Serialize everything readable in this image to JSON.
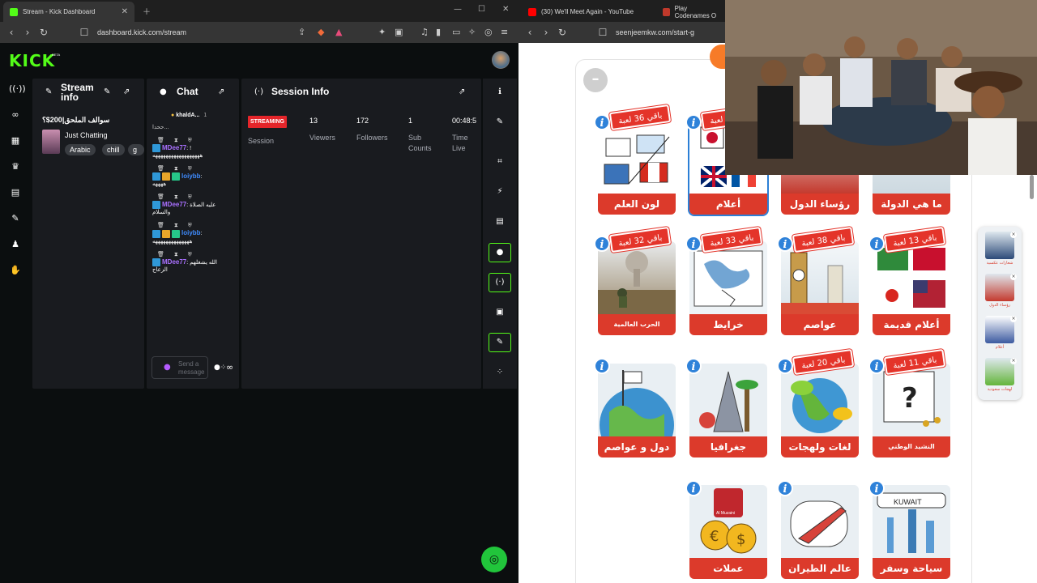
{
  "left_browser": {
    "tab_title": "Stream - Kick Dashboard",
    "url": "dashboard.kick.com/stream",
    "brand_color": "#53fc18"
  },
  "kick": {
    "logo": "KICK",
    "beta": "BETA",
    "rail_icons": [
      "broadcast-icon",
      "link-icon",
      "analytics-icon",
      "trophy-icon",
      "video-icon",
      "wrench-icon",
      "users-icon",
      "hand-icon"
    ]
  },
  "stream_info": {
    "title": "Stream info",
    "stream_title": "سوالف الملحق|200$؟",
    "category": "Just Chatting",
    "tags": [
      "Arabic",
      "chill",
      "g"
    ]
  },
  "chat": {
    "title": "Chat",
    "pinned_user": "khaldA...",
    "pinned_count": "1",
    "partial_top": "ححدا...",
    "messages": [
      {
        "user": "MDee77",
        "color": "#a970ff",
        "text": "!",
        "text2": "ههههههههههههههههههه"
      },
      {
        "user": "loiybb",
        "color": "#3f8cff",
        "text": "",
        "text2": "ههههه"
      },
      {
        "user": "MDee77",
        "color": "#a970ff",
        "text": "عليه الصلاة",
        "text2": "والسلام"
      },
      {
        "user": "loiybb",
        "color": "#3f8cff",
        "text": "",
        "text2": "ههههههههههههههه"
      },
      {
        "user": "MDee77",
        "color": "#a970ff",
        "text": "الله يشغلهم",
        "text2": "الزعاج"
      }
    ],
    "input_placeholder": "Send a message",
    "infinity": "∞"
  },
  "session": {
    "title": "Session Info",
    "status_badge": "STREAMING",
    "session_label": "Session",
    "stats": [
      {
        "value": "13",
        "label": "Viewers"
      },
      {
        "value": "172",
        "label": "Followers"
      },
      {
        "value": "1",
        "label": "Sub Counts"
      },
      {
        "value": "00:48:5",
        "label": "Time Live"
      }
    ]
  },
  "right_browser": {
    "tab1": "(30) We'll Meet Again - YouTube",
    "tab2": "Play Codenames O",
    "url": "seenjeemkw.com/start-g"
  },
  "game_cards": [
    {
      "title": "ما هي الدولة",
      "remain": ""
    },
    {
      "title": "رؤساء الدول",
      "remain": ""
    },
    {
      "title": "أعلام",
      "remain": "باقي 36 لعبة"
    },
    {
      "title": "لون العلم",
      "remain": "باقي 36 لعبة"
    },
    {
      "title": "أعلام قديمة",
      "remain": "باقي 13 لعبة"
    },
    {
      "title": "عواصم",
      "remain": "باقي 38 لعبة"
    },
    {
      "title": "خرايط",
      "remain": "باقي 33 لعبة"
    },
    {
      "title": "الحرب العالمية",
      "remain": "باقي 32 لعبة"
    },
    {
      "title": "النشيد الوطني",
      "remain": "باقي 11 لعبة"
    },
    {
      "title": "لغات ولهجات",
      "remain": "باقي 20 لعبة"
    },
    {
      "title": "جغرافيا",
      "remain": ""
    },
    {
      "title": "دول و عواصم",
      "remain": ""
    },
    {
      "title": "سياحة وسفر",
      "remain": ""
    },
    {
      "title": "عالم الطيران",
      "remain": ""
    },
    {
      "title": "عملات",
      "remain": ""
    }
  ],
  "card_texts": {
    "kuwait": "KUWAIT",
    "almuzaini": "Al Muzaini"
  },
  "side_list": [
    "شعارات عكسية",
    "رؤساء الدول",
    "أعلام",
    "لهجات سعودية"
  ]
}
